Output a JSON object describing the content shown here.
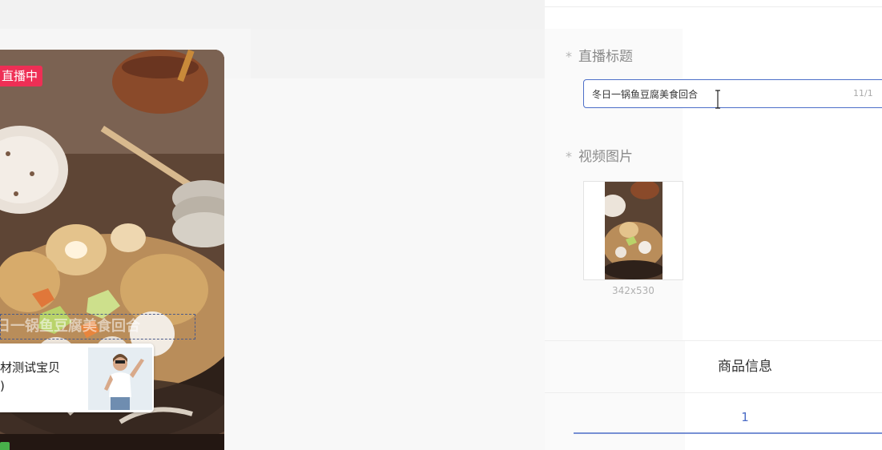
{
  "preview": {
    "live_badge": "直播中",
    "overlay_title": "日一锅鱼豆腐美食回合",
    "product_name": "材测试宝贝",
    "product_sub": ")",
    "bottom_text": ""
  },
  "form": {
    "title_label": "直播标题",
    "title_value": "冬日一锅鱼豆腐美食回合",
    "title_count": "11/1",
    "image_label": "视频图片",
    "image_size": "342x530",
    "required_mark": "*"
  },
  "tabs": {
    "goods_label": "商品信息",
    "page_number": "1"
  },
  "colors": {
    "accent": "#4a6bc6",
    "live_badge": "#ee2f55",
    "product_icon": "#48b04a"
  }
}
